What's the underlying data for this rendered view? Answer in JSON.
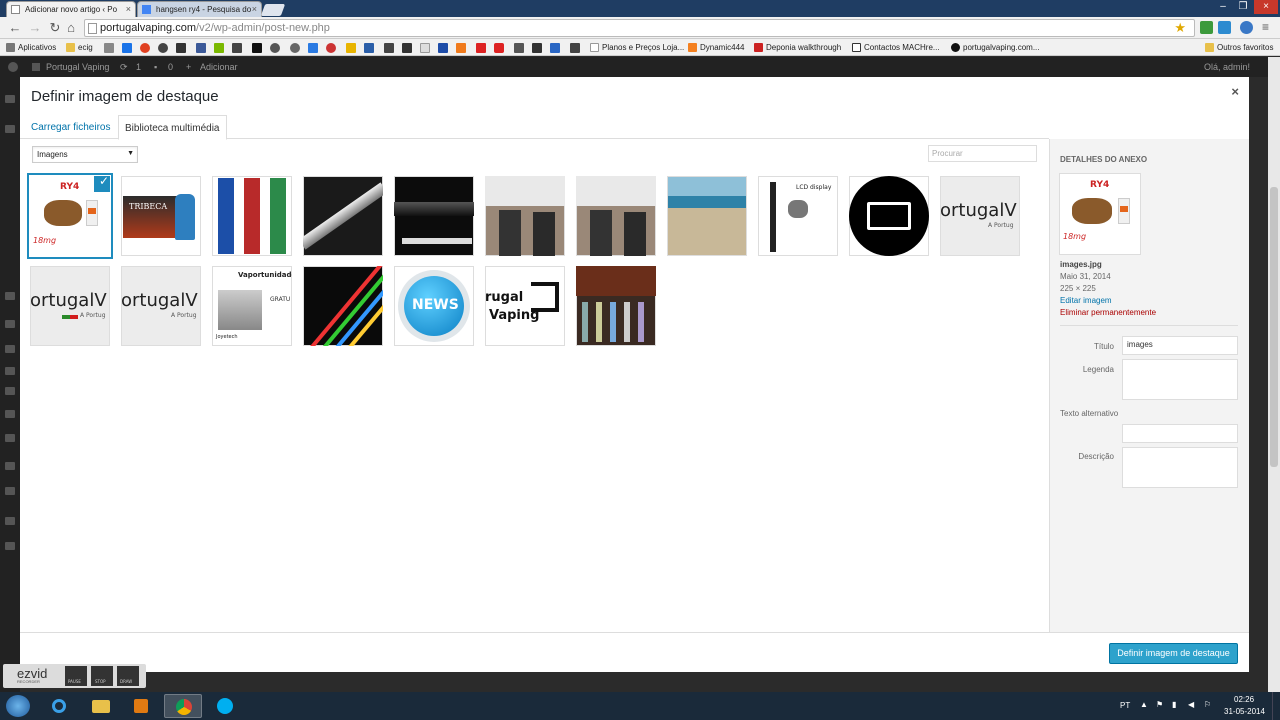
{
  "browser": {
    "tabs": [
      {
        "label": "Adicionar novo artigo ‹ Po"
      },
      {
        "label": "hangsen ry4 - Pesquisa do"
      }
    ],
    "url_host": "portugalvaping.com",
    "url_path": "/v2/wp-admin/post-new.php",
    "bookmarks": [
      {
        "label": "Aplicativos"
      },
      {
        "label": "ecig"
      },
      {
        "label": "Planos e Preços Loja..."
      },
      {
        "label": "Dynamic444"
      },
      {
        "label": "Deponia walkthrough"
      },
      {
        "label": "Contactos MACHre..."
      },
      {
        "label": "portugalvaping.com..."
      },
      {
        "label": "Outros favoritos"
      }
    ]
  },
  "wp_admin_bar": {
    "site": "Portugal Vaping",
    "updates": "1",
    "comments": "0",
    "add_new": "Adicionar",
    "greeting": "Olá, admin!"
  },
  "modal": {
    "title": "Definir imagem de destaque",
    "close_label": "×",
    "tabs": [
      {
        "label": "Carregar ficheiros",
        "active": false
      },
      {
        "label": "Biblioteca multimédia",
        "active": true
      }
    ],
    "filter_value": "Imagens",
    "search_placeholder": "Procurar",
    "thumb_labels": {
      "ry4": "RY4",
      "ry4_mg": "18mg",
      "tribeca": "TRIBECA",
      "portugal": "ortugalV",
      "portugal_sub": "A Portug",
      "news": "NEWS",
      "lcd": "LCD display",
      "vaporunidade": "Vaportunidade",
      "gratis": "GRATU",
      "joyetech": "Joyetech",
      "pv1": "rugal",
      "pv2": "Vaping"
    },
    "attachments": [
      {
        "name": "ry4-tobacco",
        "selected": true
      },
      {
        "name": "tribeca"
      },
      {
        "name": "colored-mods"
      },
      {
        "name": "silver-ecig"
      },
      {
        "name": "evolved-black"
      },
      {
        "name": "vapers-photo-1"
      },
      {
        "name": "vapers-photo-2"
      },
      {
        "name": "city-aerial"
      },
      {
        "name": "lcd-display-kit"
      },
      {
        "name": "pv-logo-circle"
      },
      {
        "name": "portugalvaping-banner-1"
      },
      {
        "name": "portugalvaping-banner-2"
      },
      {
        "name": "portugalvaping-banner-3"
      },
      {
        "name": "vaportunidade-joyetech"
      },
      {
        "name": "rainbow-light"
      },
      {
        "name": "news-badge"
      },
      {
        "name": "portugal-vaping-logo"
      },
      {
        "name": "store-shelves"
      }
    ],
    "details": {
      "heading": "Detalhes do anexo",
      "filename": "images.jpg",
      "date": "Maio 31, 2014",
      "dimensions": "225 × 225",
      "edit_link": "Editar imagem",
      "delete_link": "Eliminar permanentemente",
      "fields": {
        "title_label": "Título",
        "title_value": "images",
        "caption_label": "Legenda",
        "alt_label": "Texto alternativo",
        "description_label": "Descrição"
      }
    },
    "primary_button": "Definir imagem de destaque"
  },
  "taskbar": {
    "language": "PT",
    "time": "02:26",
    "date": "31-05-2014"
  },
  "recorder": {
    "brand": "ezvid",
    "sub": "RECORDER",
    "pause": "PAUSE",
    "stop": "STOP",
    "draw": "DRAW"
  }
}
